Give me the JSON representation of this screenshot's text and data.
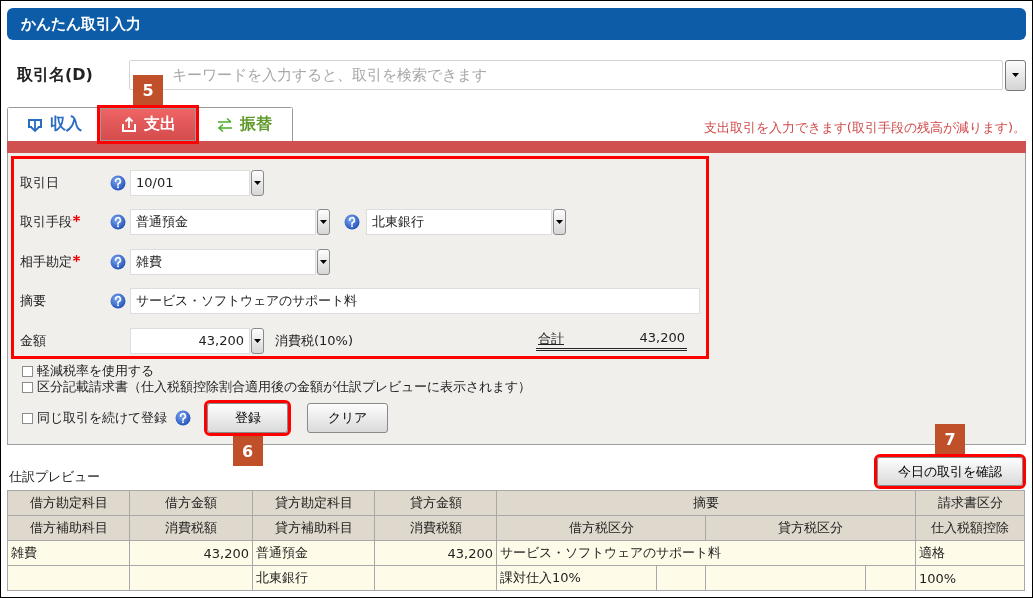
{
  "title": "かんたん取引入力",
  "search": {
    "label": "取引名(D)",
    "placeholder": "キーワードを入力すると、取引を検索できます"
  },
  "tabs": [
    {
      "label": "収入",
      "kind": "income",
      "selected": false,
      "highlighted": false
    },
    {
      "label": "支出",
      "kind": "expense",
      "selected": true,
      "highlighted": true,
      "annotation": "5"
    },
    {
      "label": "振替",
      "kind": "transfer",
      "selected": false,
      "highlighted": false
    }
  ],
  "tab_message": "支出取引を入力できます(取引手段の残高が減ります)。",
  "form": {
    "highlighted": true,
    "rows": [
      {
        "kind": "select",
        "label": "取引日",
        "required": false,
        "help": true,
        "value": "10/01"
      },
      {
        "kind": "select_pair",
        "label": "取引手段",
        "required": true,
        "help": true,
        "value": "普通預金",
        "help_2": true,
        "value_2": "北東銀行"
      },
      {
        "kind": "select",
        "label": "相手勘定",
        "required": true,
        "help": true,
        "value": "雑費"
      },
      {
        "kind": "text",
        "label": "摘要",
        "required": false,
        "help": true,
        "value": "サービス・ソフトウェアのサポート料"
      },
      {
        "kind": "amount",
        "label": "金額",
        "required": false,
        "help": false,
        "value": "43,200",
        "tax_label": "消費税(10%)",
        "total_label": "合計",
        "total": "43,200"
      }
    ]
  },
  "options": [
    {
      "label": "軽減税率を使用する",
      "checked": false
    },
    {
      "label": "区分記載請求書（仕入税額控除割合適用後の金額が仕訳プレビューに表示されます）",
      "checked": false
    }
  ],
  "continue_option": {
    "label": "同じ取引を続けて登録",
    "checked": false,
    "help": true
  },
  "buttons": [
    {
      "label": "登録",
      "highlighted": true,
      "annotation": "6"
    },
    {
      "label": "クリア",
      "highlighted": false
    }
  ],
  "preview": {
    "title": "仕訳プレビュー",
    "button": {
      "label": "今日の取引を確認",
      "highlighted": true,
      "annotation": "7"
    },
    "header_rows": [
      [
        {
          "kind": "text",
          "text": "借方勘定科目"
        },
        {
          "kind": "text",
          "text": "借方金額"
        },
        {
          "kind": "text",
          "text": "貸方勘定科目"
        },
        {
          "kind": "text",
          "text": "貸方金額"
        },
        {
          "kind": "wide",
          "text": "摘要"
        },
        {
          "kind": "text",
          "text": "請求書区分"
        }
      ],
      [
        {
          "kind": "text",
          "text": "借方補助科目"
        },
        {
          "kind": "text",
          "text": "消費税額"
        },
        {
          "kind": "text",
          "text": "貸方補助科目"
        },
        {
          "kind": "text",
          "text": "消費税額"
        },
        {
          "kind": "mid",
          "text": "借方税区分"
        },
        {
          "kind": "mid",
          "text": "貸方税区分"
        },
        {
          "kind": "text",
          "text": "仕入税額控除"
        }
      ]
    ],
    "rows": [
      [
        {
          "kind": "text",
          "text": "雑費"
        },
        {
          "kind": "number",
          "text": "43,200"
        },
        {
          "kind": "text",
          "text": "普通預金"
        },
        {
          "kind": "number",
          "text": "43,200"
        },
        {
          "kind": "wide",
          "text": "サービス・ソフトウェアのサポート料"
        },
        {
          "kind": "text",
          "text": "適格"
        }
      ],
      [
        {
          "kind": "empty"
        },
        {
          "kind": "empty"
        },
        {
          "kind": "text",
          "text": "北東銀行"
        },
        {
          "kind": "empty"
        },
        {
          "kind": "text",
          "text": "課対仕入10%"
        },
        {
          "kind": "empty"
        },
        {
          "kind": "empty"
        },
        {
          "kind": "empty"
        },
        {
          "kind": "text",
          "text": "100%"
        }
      ]
    ]
  }
}
